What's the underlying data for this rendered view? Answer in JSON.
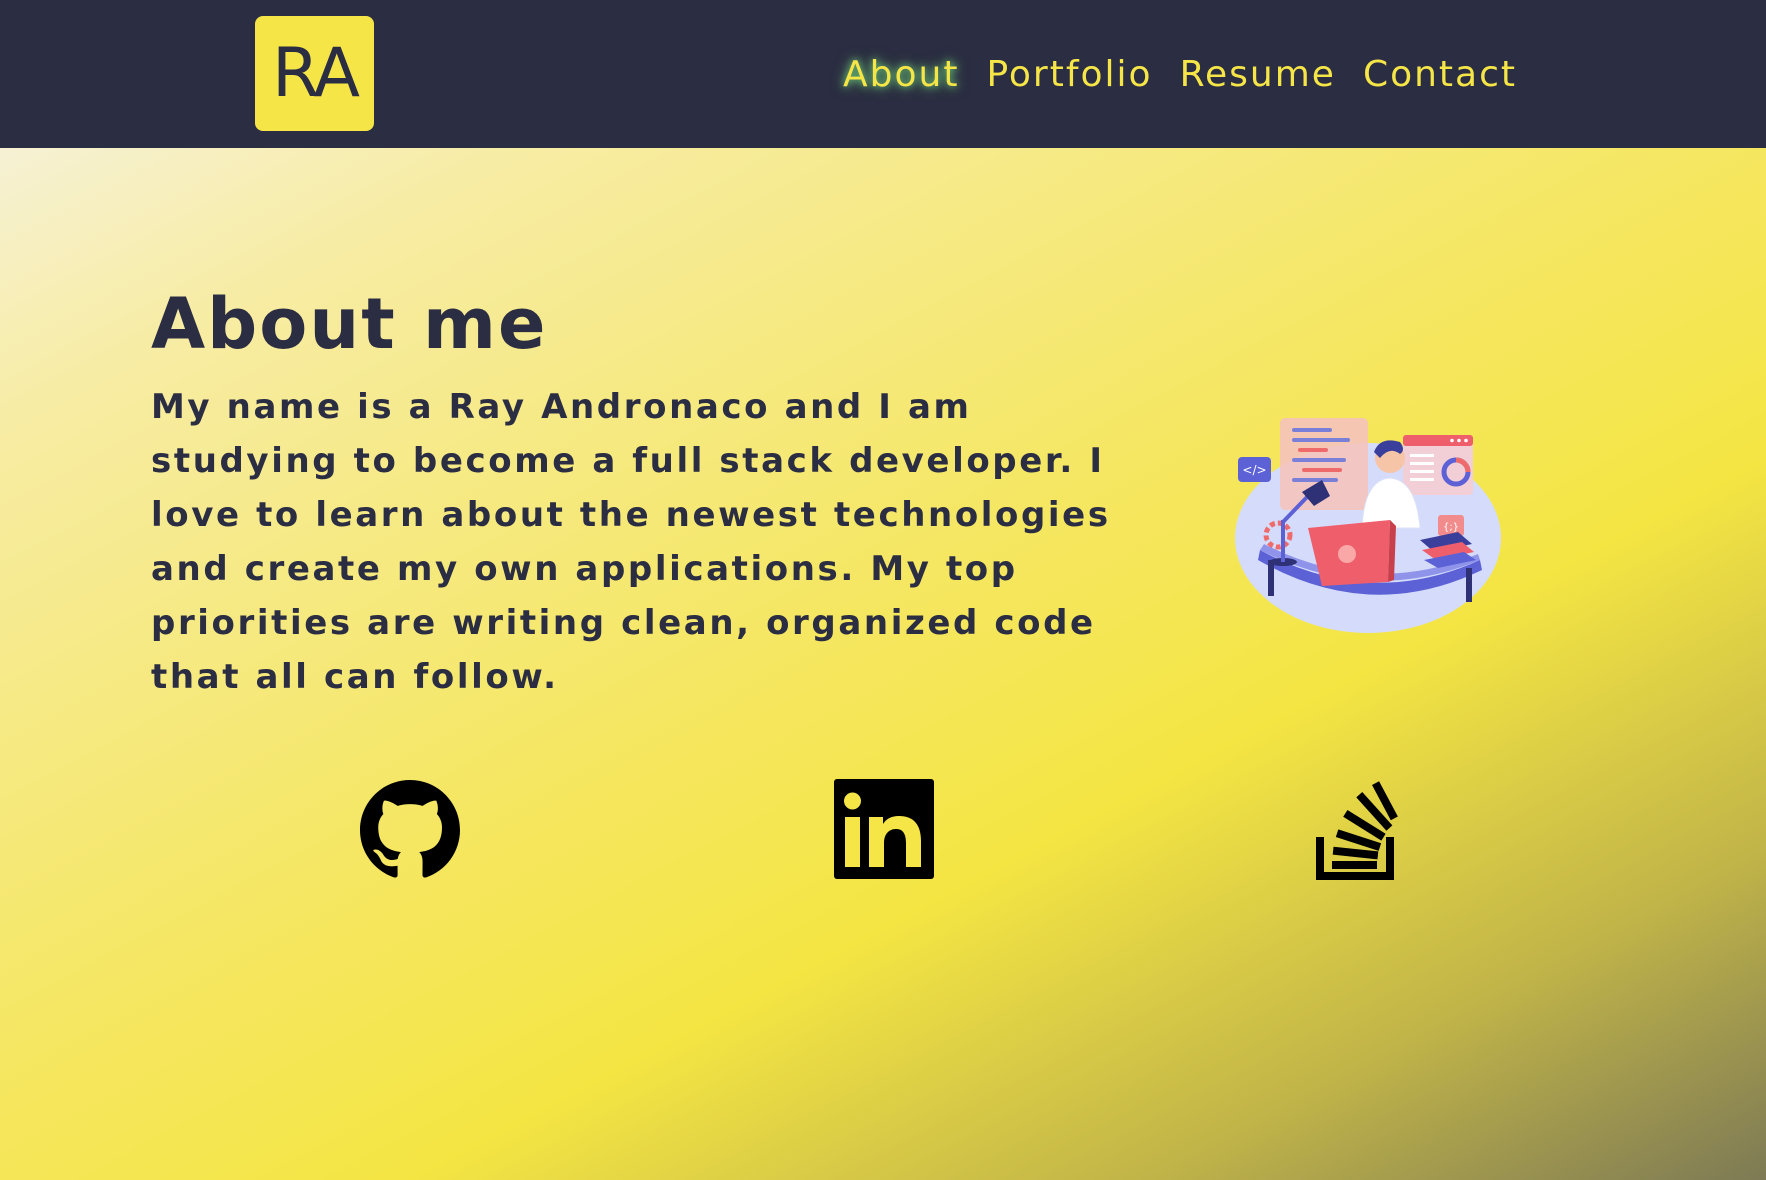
{
  "header": {
    "logo_text": "RA",
    "nav": [
      {
        "label": "About",
        "active": true
      },
      {
        "label": "Portfolio",
        "active": false
      },
      {
        "label": "Resume",
        "active": false
      },
      {
        "label": "Contact",
        "active": false
      }
    ]
  },
  "about": {
    "title": "About me",
    "body": "My name is a Ray Andronaco and I am studying to become a full stack developer. I love to learn about the newest technologies and create my own applications. My top priorities are writing clean, organized code that all can follow.",
    "illustration": "developer-at-desk-illustration",
    "illustration_labels": [
      "</>",
      "{;}"
    ]
  },
  "social": [
    {
      "name": "GitHub",
      "icon": "github-icon"
    },
    {
      "name": "LinkedIn",
      "icon": "linkedin-icon"
    },
    {
      "name": "Stack Overflow",
      "icon": "stackoverflow-icon"
    }
  ],
  "colors": {
    "navbar": "#2b2d42",
    "accent": "#f5e547",
    "text": "#2b2d42"
  }
}
